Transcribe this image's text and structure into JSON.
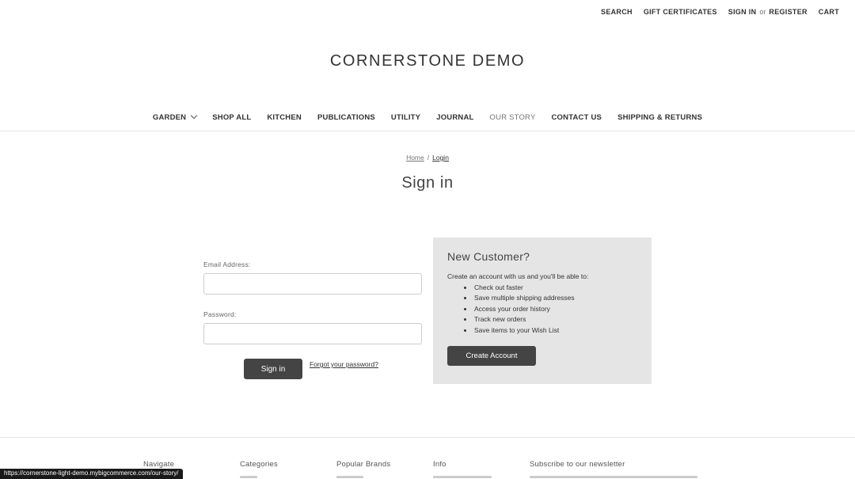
{
  "topbar": {
    "search": "SEARCH",
    "gift": "GIFT CERTIFICATES",
    "signin": "SIGN IN",
    "or": "or",
    "register": "REGISTER",
    "cart": "CART"
  },
  "logo": "CORNERSTONE DEMO",
  "nav": [
    {
      "label": "GARDEN"
    },
    {
      "label": "SHOP ALL"
    },
    {
      "label": "KITCHEN"
    },
    {
      "label": "PUBLICATIONS"
    },
    {
      "label": "UTILITY"
    },
    {
      "label": "JOURNAL"
    },
    {
      "label": "OUR STORY"
    },
    {
      "label": "CONTACT US"
    },
    {
      "label": "SHIPPING & RETURNS"
    }
  ],
  "breadcrumb": {
    "home": "Home",
    "sep": "/",
    "current": "Login"
  },
  "page_title": "Sign in",
  "form": {
    "email_label": "Email Address:",
    "email_value": "",
    "password_label": "Password:",
    "password_value": "",
    "signin_button": "Sign in",
    "forgot_link": "Forgot your password?"
  },
  "new_customer": {
    "heading": "New Customer?",
    "intro": "Create an account with us and you'll be able to:",
    "benefits": [
      "Check out faster",
      "Save multiple shipping addresses",
      "Access your order history",
      "Track new orders",
      "Save items to your Wish List"
    ],
    "create_button": "Create Account"
  },
  "footer": {
    "navigate": "Navigate",
    "categories": "Categories",
    "brands": "Popular Brands",
    "info": "Info",
    "newsletter": "Subscribe to our newsletter"
  },
  "status_url": "https://cornerstone-light-demo.mybigcommerce.com/our-story/"
}
